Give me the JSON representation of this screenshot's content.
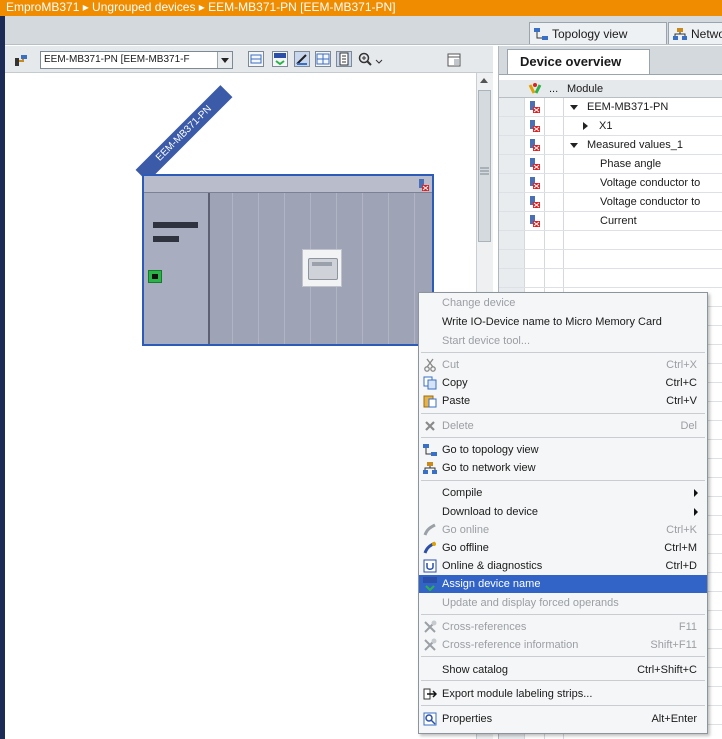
{
  "breadcrumb": {
    "text": "EmproMB371 ▸ Ungrouped devices ▸ EEM-MB371-PN [EEM-MB371-PN]"
  },
  "view_tabs": {
    "topology": "Topology view",
    "network": "Network"
  },
  "toolbar": {
    "device_select_value": "EEM-MB371-PN [EEM-MB371-F"
  },
  "canvas": {
    "device_label": "EEM-MB371-PN"
  },
  "device_overview": {
    "tab_label": "Device overview",
    "header": {
      "col_dots": "...",
      "col_module": "Module"
    },
    "rows": [
      {
        "label": "EEM-MB371-PN",
        "expander": "expanded"
      },
      {
        "label": "X1",
        "expander": "collapsed"
      },
      {
        "label": "Measured values_1",
        "expander": "expanded"
      },
      {
        "label": "Phase angle",
        "expander": "none"
      },
      {
        "label": "Voltage conductor to",
        "expander": "none"
      },
      {
        "label": "Voltage conductor to",
        "expander": "none"
      },
      {
        "label": "Current",
        "expander": "none"
      }
    ]
  },
  "context_menu": {
    "items": [
      {
        "label": "Change device",
        "shortcut": "",
        "disabled": true,
        "icon": ""
      },
      {
        "label": "Write IO-Device name to Micro Memory Card",
        "shortcut": "",
        "disabled": false,
        "icon": ""
      },
      {
        "label": "Start device tool...",
        "shortcut": "",
        "disabled": true,
        "icon": ""
      },
      {
        "label": "Cut",
        "shortcut": "Ctrl+X",
        "disabled": true,
        "icon": "scissors-icon"
      },
      {
        "label": "Copy",
        "shortcut": "Ctrl+C",
        "disabled": false,
        "icon": "copy-icon"
      },
      {
        "label": "Paste",
        "shortcut": "Ctrl+V",
        "disabled": false,
        "icon": "paste-icon"
      },
      {
        "label": "Delete",
        "shortcut": "Del",
        "disabled": true,
        "icon": "delete-x-icon"
      },
      {
        "label": "Go to topology view",
        "shortcut": "",
        "disabled": false,
        "icon": "topology-icon"
      },
      {
        "label": "Go to network view",
        "shortcut": "",
        "disabled": false,
        "icon": "network-icon"
      },
      {
        "label": "Compile",
        "shortcut": "",
        "disabled": false,
        "icon": ""
      },
      {
        "label": "Download to device",
        "shortcut": "",
        "disabled": false,
        "icon": ""
      },
      {
        "label": "Go online",
        "shortcut": "Ctrl+K",
        "disabled": true,
        "icon": "go-online-icon"
      },
      {
        "label": "Go offline",
        "shortcut": "Ctrl+M",
        "disabled": false,
        "icon": "go-offline-icon"
      },
      {
        "label": "Online & diagnostics",
        "shortcut": "Ctrl+D",
        "disabled": false,
        "icon": "diagnostics-icon"
      },
      {
        "label": "Assign device name",
        "shortcut": "",
        "disabled": false,
        "icon": "assign-name-icon"
      },
      {
        "label": "Update and display forced operands",
        "shortcut": "",
        "disabled": true,
        "icon": ""
      },
      {
        "label": "Cross-references",
        "shortcut": "F11",
        "disabled": true,
        "icon": "cross-reference-icon"
      },
      {
        "label": "Cross-reference information",
        "shortcut": "Shift+F11",
        "disabled": true,
        "icon": "cross-reference-icon"
      },
      {
        "label": "Show catalog",
        "shortcut": "Ctrl+Shift+C",
        "disabled": false,
        "icon": ""
      },
      {
        "label": "Export module labeling strips...",
        "shortcut": "",
        "disabled": false,
        "icon": "export-arrow-icon"
      },
      {
        "label": "Properties",
        "shortcut": "Alt+Enter",
        "disabled": false,
        "icon": "properties-icon"
      }
    ],
    "selected_item": "Assign device name"
  },
  "colors": {
    "breadcrumb_bg": "#f08c00",
    "selection": "#3264c8",
    "device_border": "#2d5bb8",
    "device_label_bg": "#3b5ba8",
    "port_green": "#2bb34a",
    "error_red": "#e02020"
  }
}
